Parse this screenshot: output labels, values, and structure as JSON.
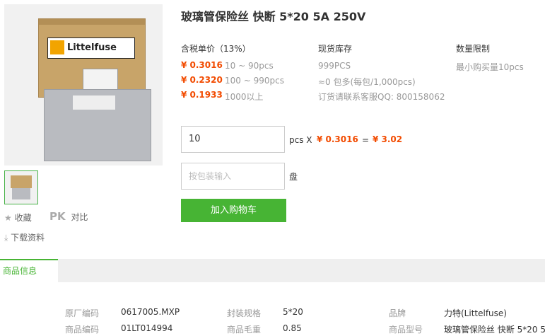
{
  "product": {
    "title": "玻璃管保险丝 快断 5*20 5A 250V",
    "brand_logo": "Littelfuse"
  },
  "actions": {
    "favorite_label": "收藏",
    "pk_label": "PK",
    "compare_label": "对比",
    "download_label": "下载资料"
  },
  "pricing": {
    "header": "含税单价（13%）",
    "tiers": [
      {
        "price": "¥ 0.3016",
        "range": "10 ~ 90pcs"
      },
      {
        "price": "¥ 0.2320",
        "range": "100 ~ 990pcs"
      },
      {
        "price": "¥ 0.1933",
        "range": "1000以上"
      }
    ]
  },
  "stock": {
    "header": "现货库存",
    "quantity": "999PCS",
    "package": "≈0 包多(每包/1,000pcs)",
    "contact": "订货请联系客服QQ: 800158062"
  },
  "limit": {
    "header": "数量限制",
    "text": "最小购买量10pcs"
  },
  "order": {
    "quantity_value": "10",
    "unit_label": "pcs X",
    "unit_price": "¥ 0.3016",
    "equals": "=",
    "total": "¥ 3.02",
    "pack_placeholder": "按包装输入",
    "pack_unit": "盘",
    "add_to_cart": "加入购物车"
  },
  "tabs": {
    "info_label": "商品信息"
  },
  "specs": [
    {
      "key": "原厂编码",
      "value": "0617005.MXP"
    },
    {
      "key": "封装规格",
      "value": "5*20"
    },
    {
      "key": "品牌",
      "value": "力特(Littelfuse)"
    },
    {
      "key": "商品编码",
      "value": "01LT014994"
    },
    {
      "key": "商品毛重",
      "value": "0.85"
    },
    {
      "key": "商品型号",
      "value": "玻璃管保险丝 快断 5*20 5..."
    }
  ],
  "colors": {
    "accent_green": "#47b434",
    "price_orange": "#f24b00"
  }
}
